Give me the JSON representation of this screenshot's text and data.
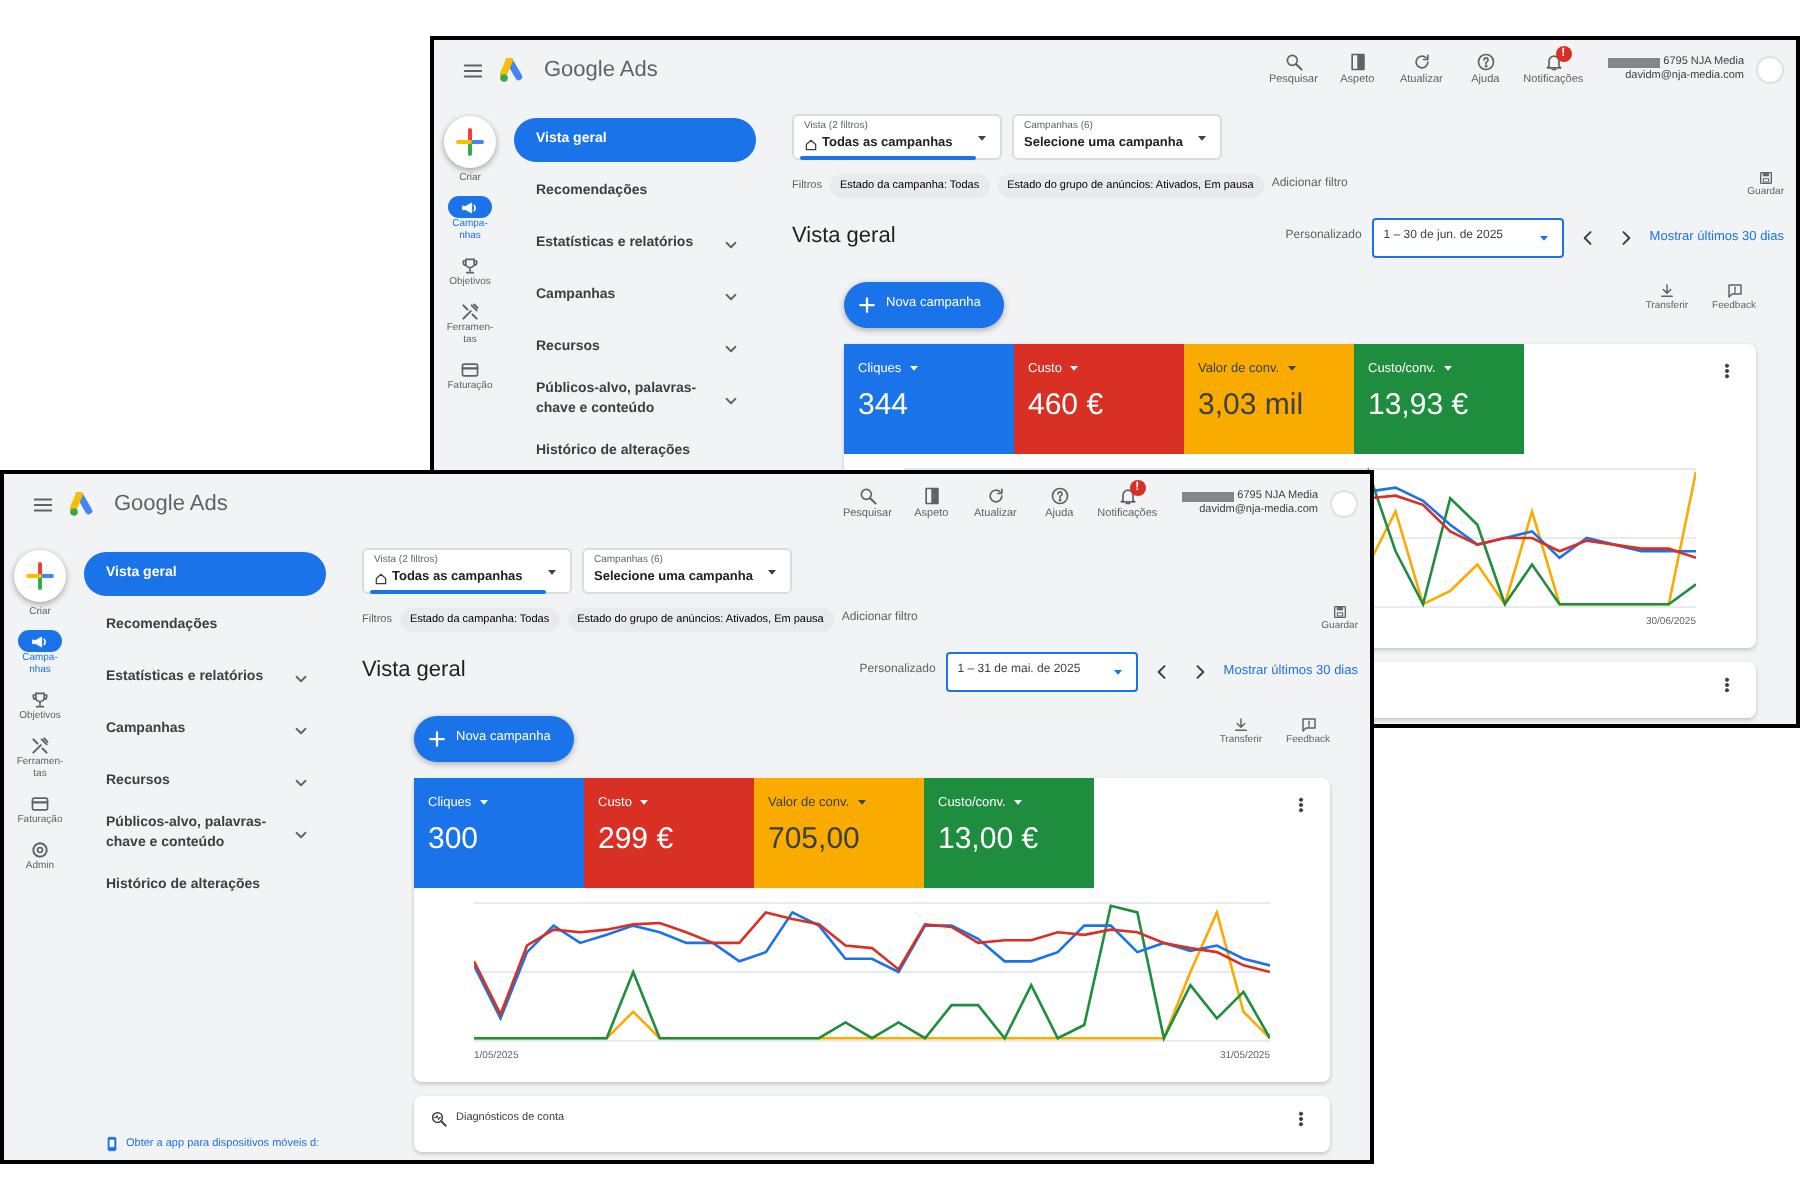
{
  "windows": [
    {
      "header": {
        "product": "Google Ads",
        "tools": [
          {
            "kind": "search",
            "label": "Pesquisar"
          },
          {
            "kind": "appearance",
            "label": "Aspeto"
          },
          {
            "kind": "refresh",
            "label": "Atualizar"
          },
          {
            "kind": "help",
            "label": "Ajuda"
          },
          {
            "kind": "notifications",
            "label": "Notificações",
            "badge": "!"
          }
        ],
        "account": {
          "name": "6795 NJA Media",
          "email": "davidm@nja-media.com"
        }
      },
      "rail": [
        {
          "kind": "create",
          "label": "Criar",
          "selected": false
        },
        {
          "kind": "campaigns",
          "label": "Campa-nhas",
          "selected": true
        },
        {
          "kind": "goals",
          "label": "Objetivos",
          "selected": false
        },
        {
          "kind": "tools",
          "label": "Ferramen-tas",
          "selected": false
        },
        {
          "kind": "billing",
          "label": "Faturação",
          "selected": false
        }
      ],
      "nav": [
        {
          "label": "Vista geral",
          "selected": true,
          "expandable": false
        },
        {
          "label": "Recomendações",
          "selected": false,
          "expandable": false
        },
        {
          "label": "Estatísticas e relatórios",
          "selected": false,
          "expandable": true
        },
        {
          "label": "Campanhas",
          "selected": false,
          "expandable": true
        },
        {
          "label": "Recursos",
          "selected": false,
          "expandable": true
        },
        {
          "label": "Públicos-alvo, palavras-chave e conteúdo",
          "selected": false,
          "expandable": true
        },
        {
          "label": "Histórico de alterações",
          "selected": false,
          "expandable": false
        }
      ],
      "selectors": [
        {
          "kind": "view",
          "label": "Vista (2 filtros)",
          "value": "Todas as campanhas",
          "selected": true
        },
        {
          "kind": "campaign",
          "label": "Campanhas (6)",
          "value": "Selecione uma campanha",
          "selected": false
        }
      ],
      "filters": {
        "label": "Filtros",
        "chips": [
          "Estado da campanha: Todas",
          "Estado do grupo de anúncios: Ativados, Em pausa"
        ],
        "add": "Adicionar filtro",
        "save": "Guardar"
      },
      "overview": {
        "title": "Vista geral",
        "range_label": "Personalizado",
        "date_range": "1 – 30 de jun. de 2025",
        "show_last": "Mostrar últimos 30 dias"
      },
      "actions": {
        "new_campaign": "Nova campanha",
        "download": "Transferir",
        "feedback": "Feedback"
      },
      "metrics": [
        {
          "label": "Cliques",
          "value": "344",
          "color": "#1a73e8"
        },
        {
          "label": "Custo",
          "value": "460 €",
          "color": "#d93025"
        },
        {
          "label": "Valor de conv.",
          "value": "3,03 mil",
          "color": "#f9ab00"
        },
        {
          "label": "Custo/conv.",
          "value": "13,93 €",
          "color": "#1e8e3e"
        }
      ],
      "chart": {
        "end_label": "30/06/2025"
      },
      "diagnostics": {
        "menu": true
      }
    },
    {
      "header": {
        "product": "Google Ads",
        "tools": [
          {
            "kind": "search",
            "label": "Pesquisar"
          },
          {
            "kind": "appearance",
            "label": "Aspeto"
          },
          {
            "kind": "refresh",
            "label": "Atualizar"
          },
          {
            "kind": "help",
            "label": "Ajuda"
          },
          {
            "kind": "notifications",
            "label": "Notificações",
            "badge": "!"
          }
        ],
        "account": {
          "name": "6795 NJA Media",
          "email": "davidm@nja-media.com"
        }
      },
      "rail": [
        {
          "kind": "create",
          "label": "Criar",
          "selected": false
        },
        {
          "kind": "campaigns",
          "label": "Campa-nhas",
          "selected": true
        },
        {
          "kind": "goals",
          "label": "Objetivos",
          "selected": false
        },
        {
          "kind": "tools",
          "label": "Ferramen-tas",
          "selected": false
        },
        {
          "kind": "billing",
          "label": "Faturação",
          "selected": false
        },
        {
          "kind": "admin",
          "label": "Admin",
          "selected": false
        }
      ],
      "nav": [
        {
          "label": "Vista geral",
          "selected": true,
          "expandable": false
        },
        {
          "label": "Recomendações",
          "selected": false,
          "expandable": false
        },
        {
          "label": "Estatísticas e relatórios",
          "selected": false,
          "expandable": true
        },
        {
          "label": "Campanhas",
          "selected": false,
          "expandable": true
        },
        {
          "label": "Recursos",
          "selected": false,
          "expandable": true
        },
        {
          "label": "Públicos-alvo, palavras-chave e conteúdo",
          "selected": false,
          "expandable": true
        },
        {
          "label": "Histórico de alterações",
          "selected": false,
          "expandable": false
        }
      ],
      "app_link": "Obter a app para dispositivos móveis d:",
      "selectors": [
        {
          "kind": "view",
          "label": "Vista (2 filtros)",
          "value": "Todas as campanhas",
          "selected": true
        },
        {
          "kind": "campaign",
          "label": "Campanhas (6)",
          "value": "Selecione uma campanha",
          "selected": false
        }
      ],
      "filters": {
        "label": "Filtros",
        "chips": [
          "Estado da campanha: Todas",
          "Estado do grupo de anúncios: Ativados, Em pausa"
        ],
        "add": "Adicionar filtro",
        "save": "Guardar"
      },
      "overview": {
        "title": "Vista geral",
        "range_label": "Personalizado",
        "date_range": "1 – 31 de mai. de 2025",
        "show_last": "Mostrar últimos 30 dias"
      },
      "actions": {
        "new_campaign": "Nova campanha",
        "download": "Transferir",
        "feedback": "Feedback"
      },
      "metrics": [
        {
          "label": "Cliques",
          "value": "300",
          "color": "#1a73e8"
        },
        {
          "label": "Custo",
          "value": "299 €",
          "color": "#d93025"
        },
        {
          "label": "Valor de conv.",
          "value": "705,00",
          "color": "#f9ab00"
        },
        {
          "label": "Custo/conv.",
          "value": "13,00 €",
          "color": "#1e8e3e"
        }
      ],
      "chart": {
        "start_label": "1/05/2025",
        "end_label": "31/05/2025"
      },
      "diagnostics": {
        "title": "Diagnósticos de conta",
        "menu": true
      }
    }
  ]
}
